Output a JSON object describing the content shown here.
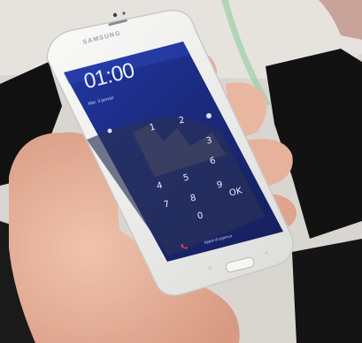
{
  "phone": {
    "brand": "SAMSUNG",
    "lock_screen": {
      "time": "01:00",
      "date": "Mar. 3 janvier",
      "keypad": [
        "1",
        "2",
        "3",
        "4",
        "5",
        "6",
        "7",
        "8",
        "9",
        "0",
        "OK"
      ],
      "emergency_text": "Appel d'urgence"
    }
  },
  "colors": {
    "screen": "#1f2f8a",
    "phone_body": "#f3f3f1",
    "background_black": "#151515"
  }
}
